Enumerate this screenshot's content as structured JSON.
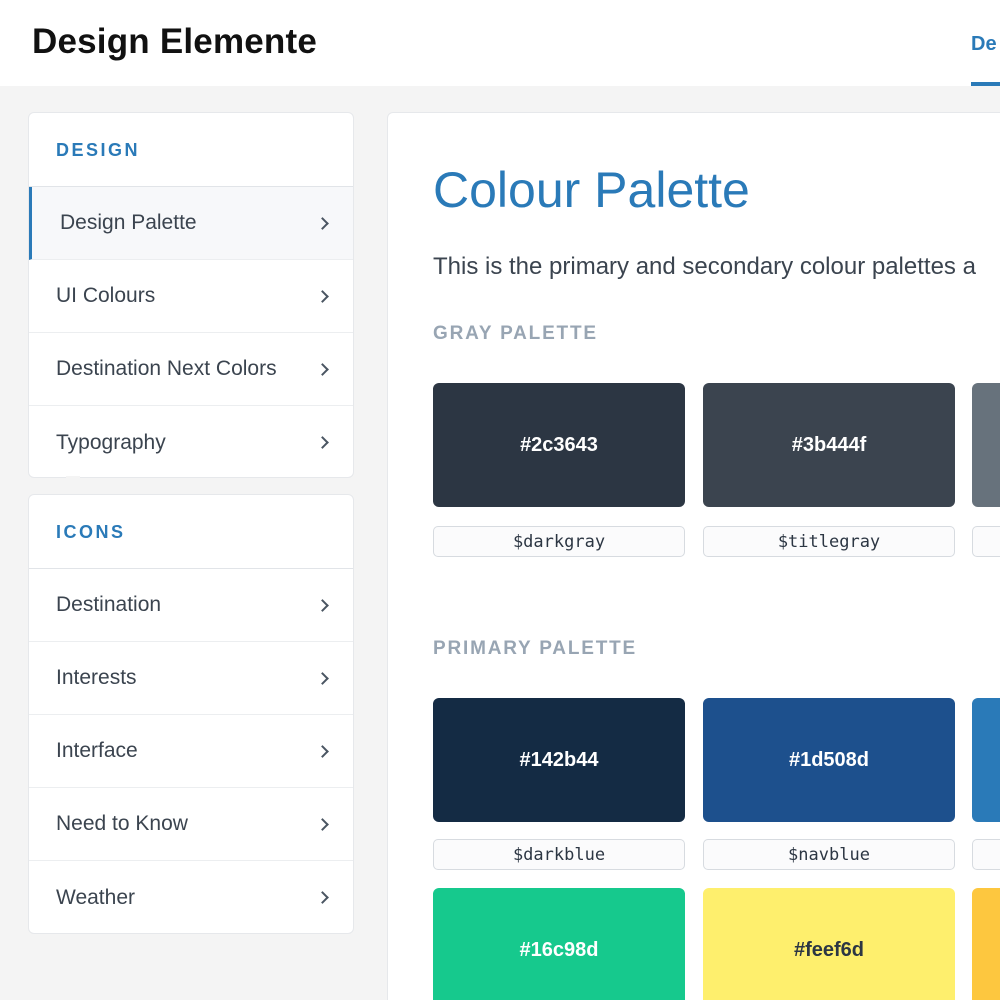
{
  "header": {
    "title": "Design Elemente",
    "tab_label": "De"
  },
  "sidebar": {
    "design": {
      "heading": "DESIGN",
      "items": [
        {
          "label": "Design Palette",
          "active": true
        },
        {
          "label": "UI Colours"
        },
        {
          "label": "Destination Next Colors"
        },
        {
          "label": "Typography"
        }
      ]
    },
    "icons": {
      "heading": "ICONS",
      "items": [
        {
          "label": "Destination"
        },
        {
          "label": "Interests"
        },
        {
          "label": "Interface"
        },
        {
          "label": "Need to Know"
        },
        {
          "label": "Weather"
        }
      ]
    }
  },
  "main": {
    "title": "Colour Palette",
    "intro": "This is the primary and secondary colour palettes a",
    "gray_palette": {
      "label": "GRAY PALETTE",
      "swatches": [
        {
          "hex": "#2c3643",
          "variable": "$darkgray",
          "color": "#2c3643",
          "text_color": "#ffffff"
        },
        {
          "hex": "#3b444f",
          "variable": "$titlegray",
          "color": "#3b444f",
          "text_color": "#ffffff"
        },
        {
          "color": "#67727c"
        }
      ]
    },
    "primary_palette": {
      "label": "PRIMARY PALETTE",
      "swatches": [
        {
          "hex": "#142b44",
          "variable": "$darkblue",
          "color": "#142b44",
          "text_color": "#ffffff"
        },
        {
          "hex": "#1d508d",
          "variable": "$navblue",
          "color": "#1d508d",
          "text_color": "#ffffff"
        },
        {
          "color": "#2a7ab8"
        },
        {
          "hex": "#16c98d",
          "color": "#16c98d",
          "text_color": "#ffffff"
        },
        {
          "hex": "#feef6d",
          "color": "#feef6d",
          "text_color": "#2c3643"
        },
        {
          "color": "#fdc73f"
        }
      ]
    }
  },
  "colors": {
    "accent": "#2a7ab8",
    "background": "#f4f4f4",
    "section_label": "#98a5b3"
  },
  "icons": {
    "nav_chevron": "chevron-right-icon"
  }
}
